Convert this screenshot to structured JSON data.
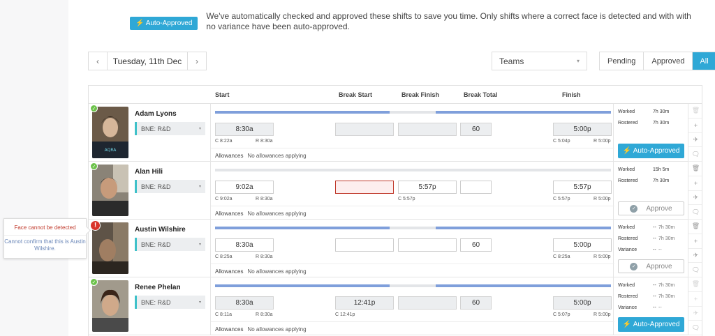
{
  "notice": {
    "badge": "Auto-Approved",
    "text": "We've automatically checked and approved these shifts to save you time. Only shifts where a correct face is detected and with with no variance have been auto-approved."
  },
  "date_nav": {
    "prev": "‹",
    "date": "Tuesday, 11th Dec",
    "next": "›"
  },
  "teams_select": {
    "value": "Teams"
  },
  "filters": {
    "pending": "Pending",
    "approved": "Approved",
    "all": "All"
  },
  "columns": {
    "start": "Start",
    "break_start": "Break Start",
    "break_finish": "Break Finish",
    "break_total": "Break Total",
    "finish": "Finish"
  },
  "icons": {
    "bolt": "⚡",
    "check": "✓",
    "error": "!",
    "trash": "🗑",
    "plus": "+",
    "plane": "✈",
    "comment": "🗨",
    "caret": "▾"
  },
  "colors": {
    "accent": "#2fa8d6",
    "success": "#6cc24a",
    "error": "#d9342b",
    "bar": "#7f9fdb",
    "team_marker": "#3fc1c9"
  },
  "rows": [
    {
      "name": "Adam Lyons",
      "team": "BNE: R&D",
      "status": "ok",
      "start": "8:30a",
      "start_clock": "C 8:22a",
      "start_roster": "R 8:30a",
      "break_start": "",
      "break_start_clock": "",
      "break_finish": "",
      "break_finish_clock": "",
      "break_total": "60",
      "finish": "5:00p",
      "finish_clock": "C 5:04p",
      "finish_roster": "R 5:00p",
      "allowances_label": "Allowances",
      "allowances": "No allowances applying",
      "worked_label": "Worked",
      "worked": "7h 30m",
      "rostered_label": "Rostered",
      "rostered": "7h 30m",
      "action": "Auto-Approved"
    },
    {
      "name": "Alan Hili",
      "team": "BNE: R&D",
      "status": "ok",
      "start": "9:02a",
      "start_clock": "C 9:02a",
      "start_roster": "R 8:30a",
      "break_start": "",
      "break_start_clock": "",
      "break_finish": "5:57p",
      "break_finish_clock": "C 5:57p",
      "break_total": "",
      "finish": "5:57p",
      "finish_clock": "C 5:57p",
      "finish_roster": "R 5:00p",
      "allowances_label": "Allowances",
      "allowances": "No allowances applying",
      "worked_label": "Worked",
      "worked": "15h 5m",
      "rostered_label": "Rostered",
      "rostered": "7h 30m",
      "action": "Approve"
    },
    {
      "name": "Austin Wilshire",
      "team": "BNE: R&D",
      "status": "error",
      "start": "8:30a",
      "start_clock": "C 8:25a",
      "start_roster": "R 8:30a",
      "break_start": "",
      "break_start_clock": "",
      "break_finish": "",
      "break_finish_clock": "",
      "break_total": "60",
      "finish": "5:00p",
      "finish_clock": "C 8:25a",
      "finish_roster": "R 5:00p",
      "allowances_label": "Allowances",
      "allowances": "No allowances applying",
      "worked_label": "Worked",
      "worked_a": "--",
      "worked": "7h 30m",
      "rostered_label": "Rostered",
      "rostered_a": "--",
      "rostered": "7h 30m",
      "variance_label": "Variance",
      "variance_a": "--",
      "variance": "--",
      "action": "Approve"
    },
    {
      "name": "Renee Phelan",
      "team": "BNE: R&D",
      "status": "ok",
      "start": "8:30a",
      "start_clock": "C 8:11a",
      "start_roster": "R 8:30a",
      "break_start": "12:41p",
      "break_start_clock": "C 12:41p",
      "break_finish": "",
      "break_finish_clock": "",
      "break_total": "60",
      "finish": "5:00p",
      "finish_clock": "C 5:07p",
      "finish_roster": "R 5:00p",
      "allowances_label": "Allowances",
      "allowances": "No allowances applying",
      "worked_label": "Worked",
      "worked_a": "--",
      "worked": "7h 30m",
      "rostered_label": "Rostered",
      "rostered_a": "--",
      "rostered": "7h 30m",
      "variance_label": "Variance",
      "variance_a": "--",
      "variance": "--",
      "action": "Auto-Approved"
    }
  ],
  "popover": {
    "title": "Face cannot be detected",
    "description": "Cannot confirm that this is Austin Wilshire."
  }
}
